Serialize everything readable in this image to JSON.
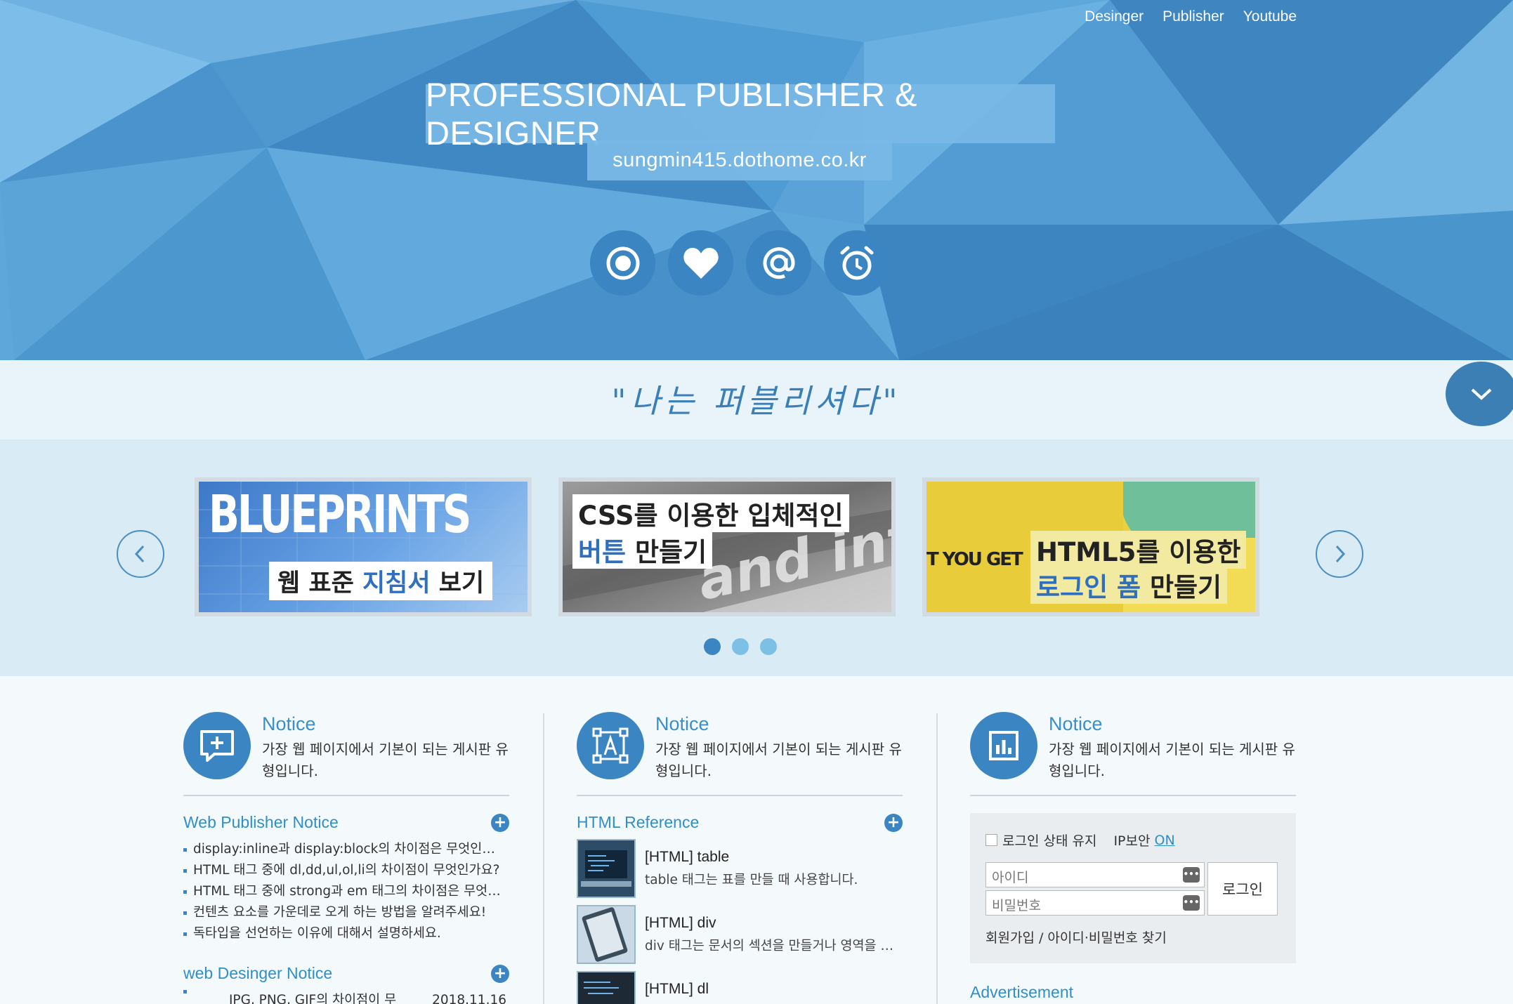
{
  "nav": {
    "links": [
      "Desinger",
      "Publisher",
      "Youtube"
    ]
  },
  "hero": {
    "title": "PROFESSIONAL PUBLISHER & DESIGNER",
    "url": "sungmin415.dothome.co.kr",
    "icons": [
      "record-icon",
      "heart-icon",
      "at-icon",
      "alarm-clock-icon"
    ]
  },
  "slogan": "\"나는 퍼블리셔다\"",
  "slider": {
    "slides": [
      {
        "big": "BLUEPRINTS",
        "line1": "웹 표준",
        "line1_accent": "지침서",
        "line1_tail": "보기"
      },
      {
        "line1": "CSS를 이용한 입체적인",
        "line2_accent": "버튼",
        "line2_tail": "만들기",
        "bg_text": "and inte"
      },
      {
        "side": "T YOU GET",
        "line1": "HTML5를 이용한",
        "line2_accent": "로그인 폼",
        "line2_tail": "만들기"
      }
    ],
    "dots": 3,
    "active_dot": 0
  },
  "columns": [
    {
      "head_title": "Notice",
      "head_desc": "가장 웹 페이지에서 기본이 되는 게시판 유형입니다.",
      "icon": "add-comment-icon",
      "sections": [
        {
          "title": "Web Publisher Notice",
          "items": [
            "display:inline과 display:block의 차이점은 무엇인가요?",
            "HTML 태그 중에 dl,dd,ul,ol,li의 차이점이 무엇인가요?",
            "HTML 태그 중에 strong과 em 태그의 차이점은 무엇인가요?",
            "컨텐츠 요소를 가운데로 오게 하는 방법을 알려주세요!",
            "독타입을 선언하는 이유에 대해서 설명하세요."
          ]
        },
        {
          "title": "web Desinger Notice",
          "items": [
            "JPG, PNG, GIF의 차이점이 무"
          ],
          "date": "2018.11.16"
        }
      ]
    },
    {
      "head_title": "Notice",
      "head_desc": "가장 웹 페이지에서 기본이 되는 게시판 유형입니다.",
      "icon": "text-frame-icon",
      "section_title": "HTML Reference",
      "refs": [
        {
          "title": "[HTML] table",
          "desc": "table 태그는 표를 만들 때 사용합니다."
        },
        {
          "title": "[HTML] div",
          "desc": "div 태그는 문서의 섹션을 만들거나 영역을 구분할 때 사용합니다."
        },
        {
          "title": "[HTML] dl",
          "desc": ""
        }
      ]
    },
    {
      "head_title": "Notice",
      "head_desc": "가장 웹 페이지에서 기본이 되는 게시판 유형입니다.",
      "icon": "bar-chart-icon",
      "login": {
        "remember": "로그인 상태 유지",
        "ipsec": "IP보안",
        "ipsec_state": "ON",
        "id_placeholder": "아이디",
        "pw_placeholder": "비밀번호",
        "button": "로그인",
        "links": "회원가입 / 아이디·비밀번호 찾기"
      },
      "advert": "Advertisement"
    }
  ],
  "colors": {
    "primary": "#3a85c2",
    "accent_text": "#2f8fc6",
    "hero_bg": "#5aa3d6"
  }
}
